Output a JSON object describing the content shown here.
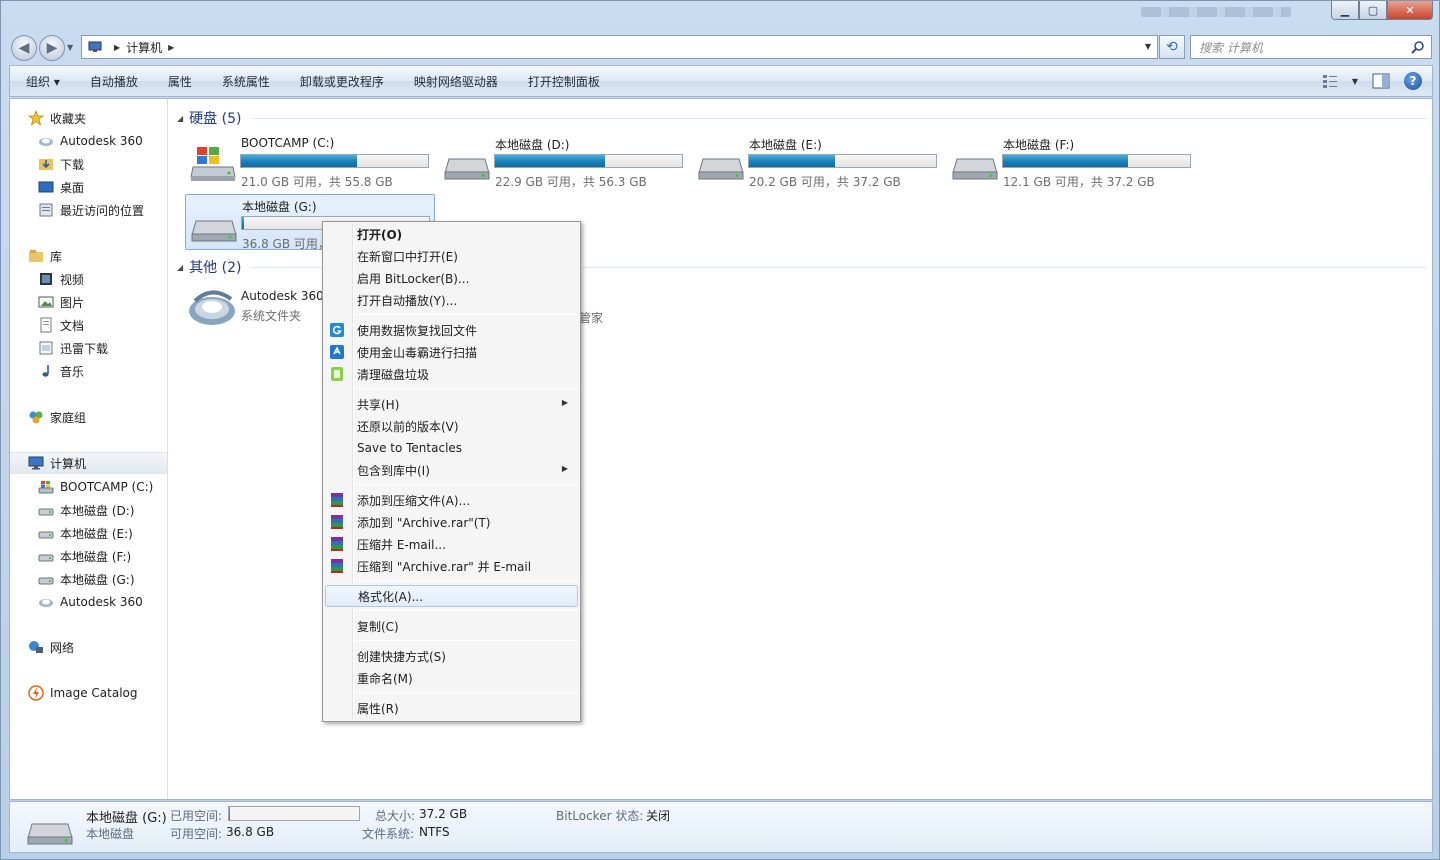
{
  "window": {
    "min_glyph": "▁",
    "max_glyph": "▢",
    "close_glyph": "✕"
  },
  "nav": {
    "back_glyph": "◀",
    "forward_glyph": "▶",
    "dropdown_glyph": "▼",
    "breadcrumb": "计算机",
    "breadcrumb_sep": "▶",
    "address_dropdown": "▼",
    "refresh_glyph": "⟲",
    "search_placeholder": "搜索 计算机"
  },
  "toolbar": {
    "organize": "组织 ▾",
    "autoplay": "自动播放",
    "properties": "属性",
    "system_properties": "系统属性",
    "uninstall": "卸载或更改程序",
    "map_drive": "映射网络驱动器",
    "control_panel": "打开控制面板",
    "view_dd": "▼",
    "help_glyph": "?"
  },
  "sidebar": {
    "favorites": "收藏夹",
    "autodesk360": "Autodesk 360",
    "downloads": "下载",
    "desktop": "桌面",
    "recent": "最近访问的位置",
    "libraries": "库",
    "videos": "视频",
    "pictures": "图片",
    "documents": "文档",
    "xunlei": "迅雷下载",
    "music": "音乐",
    "homegroup": "家庭组",
    "computer": "计算机",
    "drive_c": "BOOTCAMP (C:)",
    "drive_d": "本地磁盘 (D:)",
    "drive_e": "本地磁盘 (E:)",
    "drive_f": "本地磁盘 (F:)",
    "drive_g": "本地磁盘 (G:)",
    "autodesk360b": "Autodesk 360",
    "network": "网络",
    "image_catalog": "Image Catalog"
  },
  "groups": {
    "hard_disks": "硬盘 (5)",
    "other": "其他 (2)",
    "tri": "◢"
  },
  "drives": [
    {
      "name": "BOOTCAMP (C:)",
      "info": "21.0 GB 可用，共 55.8 GB",
      "used_pct": 62
    },
    {
      "name": "本地磁盘 (D:)",
      "info": "22.9 GB 可用，共 56.3 GB",
      "used_pct": 59
    },
    {
      "name": "本地磁盘 (E:)",
      "info": "20.2 GB 可用，共 37.2 GB",
      "used_pct": 46
    },
    {
      "name": "本地磁盘 (F:)",
      "info": "12.1 GB 可用，共 37.2 GB",
      "used_pct": 67
    },
    {
      "name": "本地磁盘 (G:)",
      "info": "36.8 GB 可用，",
      "used_pct": 1
    }
  ],
  "other_items": {
    "autodesk_name": "Autodesk 360",
    "autodesk_sub": "系统文件夹",
    "hidden_fragment": "管家"
  },
  "context_menu": {
    "open": "打开(O)",
    "open_new": "在新窗口中打开(E)",
    "bitlocker": "启用 BitLocker(B)...",
    "autoplay": "打开自动播放(Y)...",
    "recover": "使用数据恢复找回文件",
    "scan": "使用金山毒霸进行扫描",
    "clean": "清理磁盘垃圾",
    "share": "共享(H)",
    "restore": "还原以前的版本(V)",
    "tentacles": "Save to Tentacles",
    "include": "包含到库中(I)",
    "add_archive": "添加到压缩文件(A)...",
    "add_rar": "添加到 \"Archive.rar\"(T)",
    "email": "压缩并 E-mail...",
    "rar_email": "压缩到 \"Archive.rar\" 并 E-mail",
    "format": "格式化(A)...",
    "copy": "复制(C)",
    "shortcut": "创建快捷方式(S)",
    "rename": "重命名(M)",
    "props": "属性(R)",
    "submenu_arrow": "▶"
  },
  "details": {
    "name": "本地磁盘 (G:)",
    "type": "本地磁盘",
    "used_label": "已用空间:",
    "used_pct": 1,
    "free_label": "可用空间:",
    "free_value": "36.8 GB",
    "total_label": "总大小:",
    "total_value": "37.2 GB",
    "fs_label": "文件系统:",
    "fs_value": "NTFS",
    "bitlocker_label": "BitLocker 状态:",
    "bitlocker_value": "关闭"
  }
}
